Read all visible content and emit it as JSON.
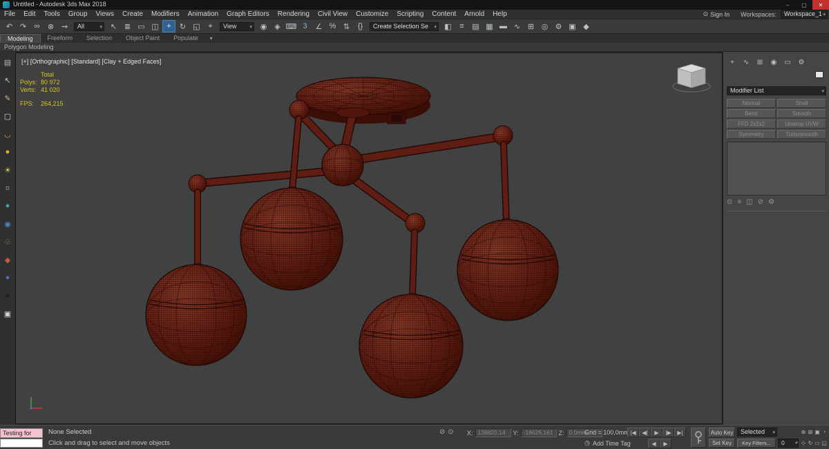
{
  "window": {
    "title": "Untitled - Autodesk 3ds Max 2018",
    "minimize": "–",
    "maximize": "▢",
    "close": "✕"
  },
  "menu": {
    "items": [
      "File",
      "Edit",
      "Tools",
      "Group",
      "Views",
      "Create",
      "Modifiers",
      "Animation",
      "Graph Editors",
      "Rendering",
      "Civil View",
      "Customize",
      "Scripting",
      "Content",
      "Arnold",
      "Help"
    ],
    "sign_in": "Sign In",
    "sign_in_icon": "⊙",
    "workspaces_label": "Workspaces:",
    "workspace": "Workspace_1"
  },
  "toolbar": {
    "selection_filter": "All",
    "reference_coordinate": "View",
    "selection_set": "Create Selection Se",
    "group1": [
      {
        "name": "undo-icon",
        "glyph": "↶"
      },
      {
        "name": "redo-icon",
        "glyph": "↷"
      },
      {
        "name": "select-and-link-icon",
        "glyph": "∞"
      },
      {
        "name": "unlink-selection-icon",
        "glyph": "⊗"
      },
      {
        "name": "bind-to-space-warp-icon",
        "glyph": "⇝"
      }
    ],
    "group2": [
      {
        "name": "select-object-icon",
        "glyph": "↖"
      },
      {
        "name": "select-by-name-icon",
        "glyph": "≣"
      },
      {
        "name": "rectangular-selection-region-icon",
        "glyph": "▭"
      },
      {
        "name": "window-crossing-icon",
        "glyph": "◫"
      }
    ],
    "group3": [
      {
        "name": "select-and-move-icon",
        "glyph": "+",
        "active": true
      },
      {
        "name": "select-and-rotate-icon",
        "glyph": "↻"
      },
      {
        "name": "select-and-scale-icon",
        "glyph": "◱"
      },
      {
        "name": "select-and-place-icon",
        "glyph": "⌖"
      }
    ],
    "group4": [
      {
        "name": "use-pivot-center-icon",
        "glyph": "◉"
      },
      {
        "name": "select-and-manipulate-icon",
        "glyph": "◈"
      },
      {
        "name": "keyboard-shortcut-override-icon",
        "glyph": "⌨"
      },
      {
        "name": "snap-toggle-3d-icon",
        "glyph": "3",
        "color": "#7ab4e8"
      },
      {
        "name": "angle-snap-icon",
        "glyph": "∠"
      },
      {
        "name": "percent-snap-icon",
        "glyph": "%"
      },
      {
        "name": "spinner-snap-icon",
        "glyph": "⇅"
      },
      {
        "name": "edit-named-selection-sets-icon",
        "glyph": "{}"
      }
    ],
    "group5": [
      {
        "name": "mirror-icon",
        "glyph": "◧"
      },
      {
        "name": "align-icon",
        "glyph": "≡"
      },
      {
        "name": "layer-manager-icon",
        "glyph": "▤"
      },
      {
        "name": "scene-explorer-icon",
        "glyph": "▦"
      },
      {
        "name": "ribbon-toggle-icon",
        "glyph": "▬"
      },
      {
        "name": "curve-editor-icon",
        "glyph": "∿"
      },
      {
        "name": "schematic-view-icon",
        "glyph": "⊞"
      },
      {
        "name": "material-editor-icon",
        "glyph": "◎"
      },
      {
        "name": "render-setup-icon",
        "glyph": "⚙"
      },
      {
        "name": "rendered-frame-window-icon",
        "glyph": "▣"
      },
      {
        "name": "render-production-icon",
        "glyph": "◆"
      }
    ]
  },
  "ribbon": {
    "tabs": [
      {
        "label": "Modeling",
        "active": true
      },
      {
        "label": "Freeform"
      },
      {
        "label": "Selection"
      },
      {
        "label": "Object Paint"
      },
      {
        "label": "Populate"
      }
    ],
    "options_icon": "▾",
    "section": "Polygon Modeling"
  },
  "left_dock": {
    "icons": [
      {
        "name": "viewport-layout-tab-icon",
        "glyph": "▤",
        "color": "#b5b5b5"
      },
      {
        "name": "cursor-icon",
        "glyph": "↖",
        "color": "#c9c9c9"
      },
      {
        "name": "pencil-icon",
        "glyph": "✎",
        "color": "#c9b98e"
      },
      {
        "name": "white-frame-icon",
        "glyph": "▢",
        "color": "#d8d8d8"
      },
      {
        "name": "gold-bowl-icon",
        "glyph": "◡",
        "color": "#cfa33e"
      },
      {
        "name": "yellow-sphere-icon",
        "glyph": "●",
        "color": "#d8b225"
      },
      {
        "name": "light-icon",
        "glyph": "☀",
        "color": "#ded26a"
      },
      {
        "name": "snowflake-icon",
        "glyph": "☼",
        "color": "#cccccc"
      },
      {
        "name": "teal-sphere-icon",
        "glyph": "●",
        "color": "#3da8a4"
      },
      {
        "name": "globe-icon",
        "glyph": "◉",
        "color": "#4f86c2"
      },
      {
        "name": "leaf-icon",
        "glyph": "♧",
        "color": "#6da24f"
      },
      {
        "name": "red-gem-icon",
        "glyph": "◆",
        "color": "#bf5a48"
      },
      {
        "name": "blue-sphere-icon",
        "glyph": "●",
        "color": "#4b6fbe"
      },
      {
        "name": "dark-cube-icon",
        "glyph": "■",
        "color": "#232323"
      },
      {
        "name": "white-cube-icon",
        "glyph": "▣",
        "color": "#d6d6d6"
      }
    ]
  },
  "viewport": {
    "label": "[+] [Orthographic] [Standard] [Clay + Edged Faces]",
    "stats": {
      "total": "Total",
      "polys_label": "Polys:",
      "polys": "80 972",
      "verts_label": "Verts:",
      "verts": "41 020",
      "fps_label": "FPS:",
      "fps": "264,215"
    }
  },
  "command_panel": {
    "tabs": [
      {
        "name": "create-tab-icon",
        "glyph": "+"
      },
      {
        "name": "modify-tab-icon",
        "glyph": "∿"
      },
      {
        "name": "hierarchy-tab-icon",
        "glyph": "⊞"
      },
      {
        "name": "motion-tab-icon",
        "glyph": "◉"
      },
      {
        "name": "display-tab-icon",
        "glyph": "▭"
      },
      {
        "name": "utilities-tab-icon",
        "glyph": "⚙"
      }
    ],
    "modifier_list": "Modifier List",
    "modifier_buttons": [
      "Normal",
      "Shell",
      "Bend",
      "Smooth",
      "FFD 2x2x2",
      "Unwrap UVW",
      "Symmetry",
      "Turbosmooth"
    ],
    "stack_icons": [
      {
        "name": "pin-stack-icon",
        "glyph": "⊙"
      },
      {
        "name": "show-end-result-icon",
        "glyph": "≡"
      },
      {
        "name": "make-unique-icon",
        "glyph": "◫"
      },
      {
        "name": "remove-modifier-icon",
        "glyph": "⊘"
      },
      {
        "name": "configure-modifier-sets-icon",
        "glyph": "⚙"
      }
    ]
  },
  "status_bar": {
    "listener_macro": "Testing for",
    "listener_script": "",
    "selection_status": "None Selected",
    "prompt": "Click and drag to select and move objects",
    "small_icons": [
      {
        "name": "isolate-selection-icon",
        "glyph": "⊘"
      },
      {
        "name": "selection-lock-icon",
        "glyph": "⊙"
      }
    ],
    "x_label": "X:",
    "x_value": "138820,14",
    "y_label": "Y:",
    "y_value": "-18626,161",
    "z_label": "Z:",
    "z_value": "0,0mm",
    "grid": "Grid = 100,0mm",
    "time_tag_icon": "◷",
    "add_time_tag": "Add Time Tag",
    "playback": [
      {
        "name": "go-to-start-button",
        "glyph": "|◀"
      },
      {
        "name": "previous-frame-button",
        "glyph": "◀|"
      },
      {
        "name": "play-button",
        "glyph": "▶"
      },
      {
        "name": "next-frame-button",
        "glyph": "|▶"
      },
      {
        "name": "go-to-end-button",
        "glyph": "▶|"
      }
    ],
    "key_steps": [
      {
        "name": "previous-key-button",
        "glyph": "◀"
      },
      {
        "name": "next-key-button",
        "glyph": "▶"
      }
    ],
    "auto_key": "Auto Key",
    "set_key": "Set Key",
    "key_mode": "Selected",
    "key_filters": "Key Filters...",
    "frame": "0",
    "nav_icons_row1": [
      {
        "name": "zoom-icon",
        "glyph": "⊕"
      },
      {
        "name": "zoom-all-icon",
        "glyph": "⊞"
      },
      {
        "name": "zoom-extents-icon",
        "glyph": "▣"
      },
      {
        "name": "field-of-view-icon",
        "glyph": "◔"
      }
    ],
    "nav_icons_row2": [
      {
        "name": "pan-icon",
        "glyph": "⊹"
      },
      {
        "name": "orbit-icon",
        "glyph": "↻"
      },
      {
        "name": "zoom-region-icon",
        "glyph": "▭"
      },
      {
        "name": "maximize-viewport-toggle-icon",
        "glyph": "◱"
      }
    ]
  }
}
